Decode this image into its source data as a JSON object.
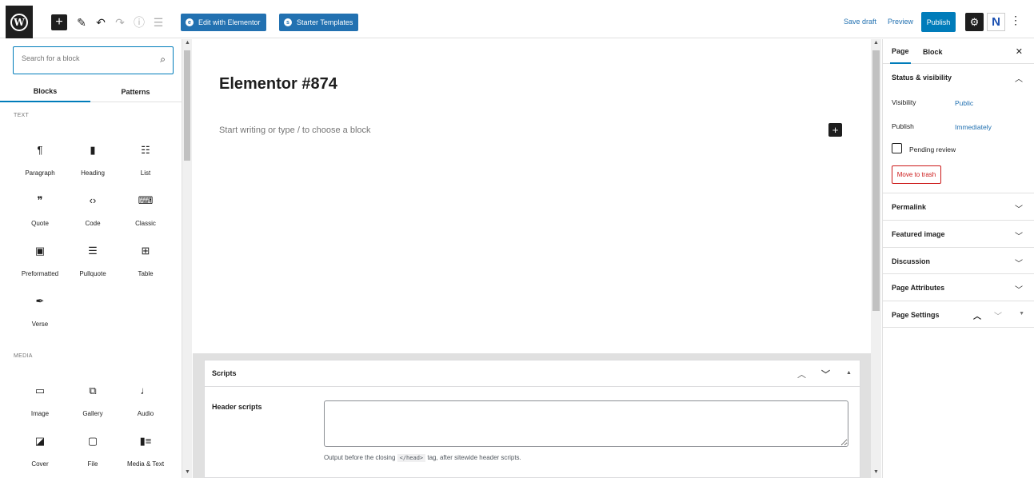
{
  "toolbar": {
    "elementor_label": "Edit with Elementor",
    "starter_label": "Starter Templates",
    "save_draft": "Save draft",
    "preview": "Preview",
    "publish": "Publish"
  },
  "inserter": {
    "search_placeholder": "Search for a block",
    "tabs": [
      "Blocks",
      "Patterns"
    ],
    "categories": [
      "TEXT",
      "MEDIA"
    ],
    "text_blocks": [
      {
        "label": "Paragraph",
        "icon": "paragraph-icon"
      },
      {
        "label": "Heading",
        "icon": "heading-icon"
      },
      {
        "label": "List",
        "icon": "list-icon"
      },
      {
        "label": "Quote",
        "icon": "quote-icon"
      },
      {
        "label": "Code",
        "icon": "code-icon"
      },
      {
        "label": "Classic",
        "icon": "classic-icon"
      },
      {
        "label": "Preformatted",
        "icon": "preformatted-icon"
      },
      {
        "label": "Pullquote",
        "icon": "pullquote-icon"
      },
      {
        "label": "Table",
        "icon": "table-icon"
      },
      {
        "label": "Verse",
        "icon": "verse-icon"
      }
    ],
    "media_blocks": [
      {
        "label": "Image",
        "icon": "image-icon"
      },
      {
        "label": "Gallery",
        "icon": "gallery-icon"
      },
      {
        "label": "Audio",
        "icon": "audio-icon"
      },
      {
        "label": "Cover",
        "icon": "cover-icon"
      },
      {
        "label": "File",
        "icon": "file-icon"
      },
      {
        "label": "Media & Text",
        "icon": "media-text-icon"
      }
    ]
  },
  "editor": {
    "title": "Elementor #874",
    "placeholder": "Start writing or type / to choose a block"
  },
  "scripts_box": {
    "title": "Scripts",
    "header_label": "Header scripts",
    "desc_before": "Output before the closing",
    "desc_code": "</head>",
    "desc_after": "tag, after sitewide header scripts."
  },
  "sidebar": {
    "tabs": [
      "Page",
      "Block"
    ],
    "status_title": "Status & visibility",
    "visibility_label": "Visibility",
    "visibility_value": "Public",
    "publish_label": "Publish",
    "publish_value": "Immediately",
    "pending_label": "Pending review",
    "trash_label": "Move to trash",
    "panels": [
      "Permalink",
      "Featured image",
      "Discussion",
      "Page Attributes",
      "Page Settings"
    ]
  }
}
